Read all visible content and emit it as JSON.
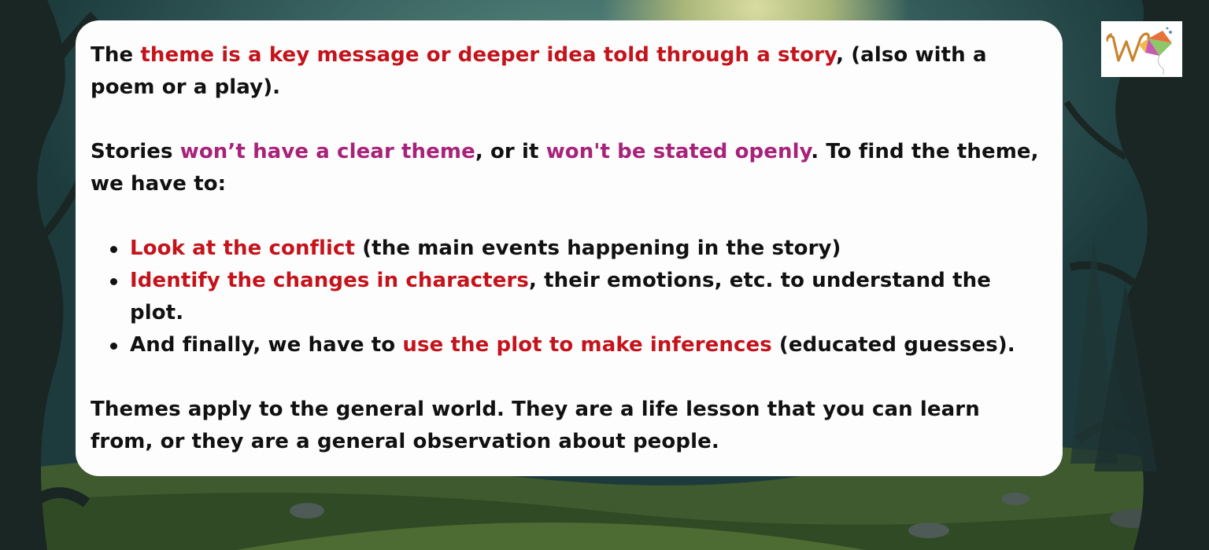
{
  "para1": {
    "t1": "The ",
    "h1": "theme is a key message or deeper idea told through a story",
    "t2": ", (also with a poem or a play)."
  },
  "para2": {
    "t1": "Stories ",
    "h1": "won’t have a clear theme",
    "t2": ", or it ",
    "h2": "won't be stated openly",
    "t3": ". To find the theme, we have to:"
  },
  "bullets": [
    {
      "h1": "Look at the conflict",
      "t1": " (the main events happening in the story)"
    },
    {
      "h1": "Identify the changes in characters",
      "t1": ", their emotions, etc. to understand the plot."
    },
    {
      "t1": "And finally, we have to ",
      "h1": "use the plot to make inferences",
      "t2": " (educated guesses)."
    }
  ],
  "para3": {
    "t1": "Themes apply to the general world. They are a life lesson that you can learn from, or they are a general observation about people."
  },
  "colors": {
    "highlight_red": "#c4131b",
    "highlight_magenta": "#a8227a",
    "text": "#111111",
    "card_background": "#fdfdfd"
  },
  "logo": {
    "icon": "w-kite-logo-icon"
  }
}
